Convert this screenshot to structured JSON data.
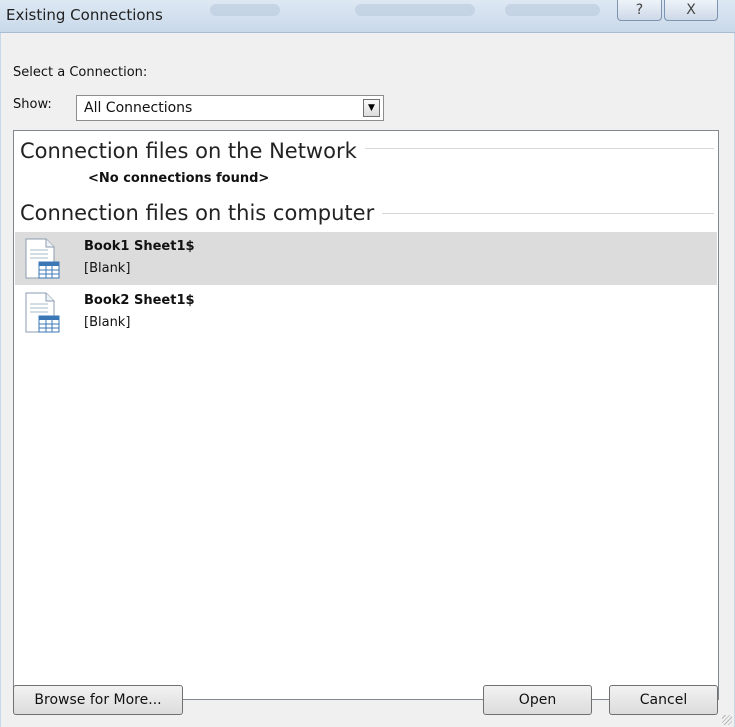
{
  "window": {
    "title": "Existing Connections",
    "help_glyph": "?",
    "close_glyph": "X"
  },
  "dialog": {
    "select_label": "Select a Connection:",
    "show_label": "Show:",
    "show_value": "All Connections"
  },
  "list": {
    "network_header": "Connection files on the Network",
    "network_empty": "<No connections found>",
    "computer_header": "Connection files on this computer",
    "items": [
      {
        "name": "Book1 Sheet1$",
        "description": "[Blank]",
        "icon": "spreadsheet-file-icon"
      },
      {
        "name": "Book2 Sheet1$",
        "description": "[Blank]",
        "icon": "spreadsheet-file-icon"
      }
    ]
  },
  "buttons": {
    "browse": "Browse for More...",
    "open": "Open",
    "cancel": "Cancel"
  },
  "colors": {
    "selected_row": "#dcdcdc",
    "title_bar": "#c9d9ea",
    "dialog_bg": "#f0f0f0"
  }
}
